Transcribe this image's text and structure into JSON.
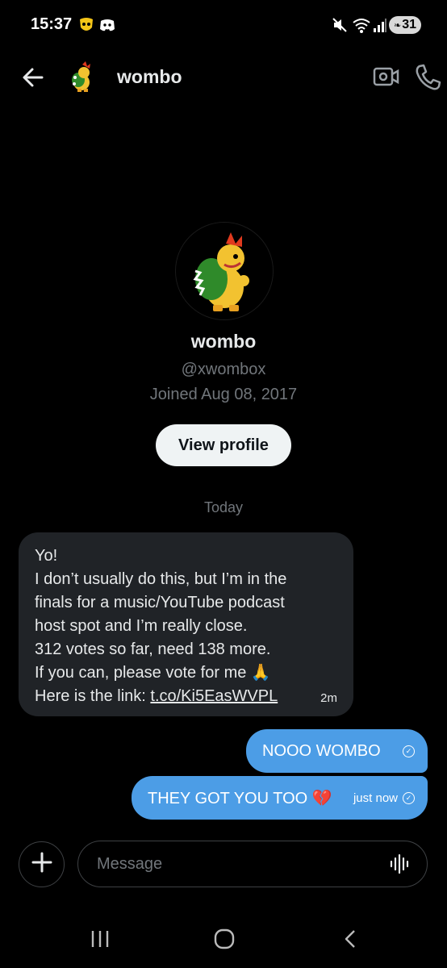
{
  "status_bar": {
    "time": "15:37",
    "battery": "31",
    "icons": [
      "grindr-icon",
      "discord-icon",
      "mute-icon",
      "wifi-icon",
      "signal-icon"
    ]
  },
  "header": {
    "name": "wombo",
    "back_icon": "arrow-left-icon",
    "video_icon": "video-call-icon",
    "call_icon": "phone-icon"
  },
  "profile": {
    "name": "wombo",
    "handle": "@xwombox",
    "joined": "Joined Aug 08, 2017",
    "view_profile_label": "View profile"
  },
  "conversation": {
    "date_separator": "Today",
    "incoming": {
      "lines": [
        "Yo!",
        "I don’t usually do this, but I’m in the",
        "finals for a music/YouTube podcast",
        "host spot and I’m really close.",
        "312 votes so far, need 138 more.",
        "If you can, please vote for me 🙏"
      ],
      "link_prefix": "Here is the link: ",
      "link_text": "t.co/Ki5EasWVPL",
      "time": "2m"
    },
    "outgoing": [
      {
        "text": "NOOO WOMBO",
        "time": ""
      },
      {
        "text": "THEY GOT YOU TOO 💔",
        "time": "just now"
      }
    ]
  },
  "composer": {
    "placeholder": "Message",
    "add_icon": "plus-icon",
    "voice_icon": "voice-wave-icon"
  },
  "nav_bar": {
    "buttons": [
      "recents-icon",
      "home-icon",
      "back-icon"
    ]
  },
  "colors": {
    "background": "#000000",
    "bubble_incoming": "#202327",
    "bubble_outgoing": "#4c9de6",
    "muted_text": "#71767b"
  }
}
